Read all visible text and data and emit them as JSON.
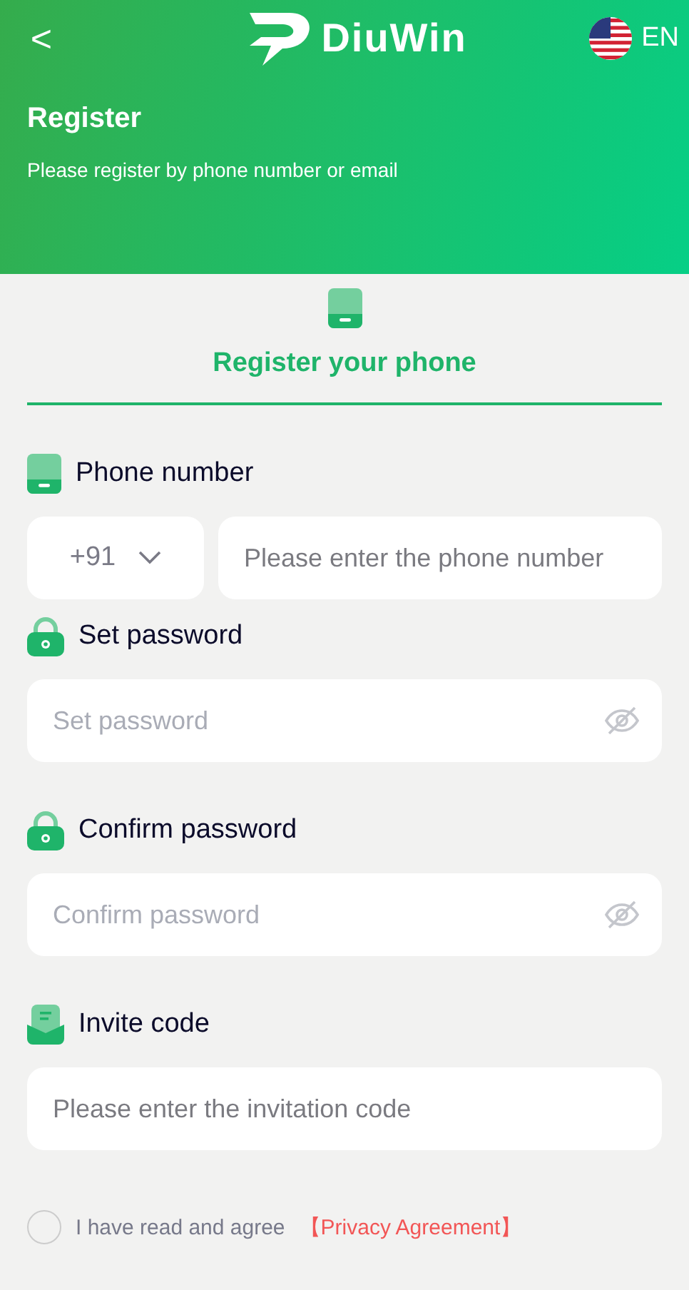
{
  "header": {
    "back": "<",
    "brand": "DiuWin",
    "language": "EN",
    "title": "Register",
    "subtitle": "Please register by phone number or email"
  },
  "tabs": [
    {
      "label": "Register your phone",
      "selected": true
    }
  ],
  "fields": [
    {
      "kind": "phone",
      "label": "Phone number",
      "country_code": "+91",
      "placeholder": "Please enter the phone number"
    },
    {
      "kind": "password",
      "label": "Set password",
      "placeholder": "Set password"
    },
    {
      "kind": "password",
      "label": "Confirm password",
      "placeholder": "Confirm password"
    },
    {
      "kind": "invite",
      "label": "Invite code",
      "placeholder": "Please enter the invitation code"
    }
  ],
  "agreement": {
    "checked": false,
    "text": "I have read and agree",
    "link": "【Privacy Agreement】"
  }
}
